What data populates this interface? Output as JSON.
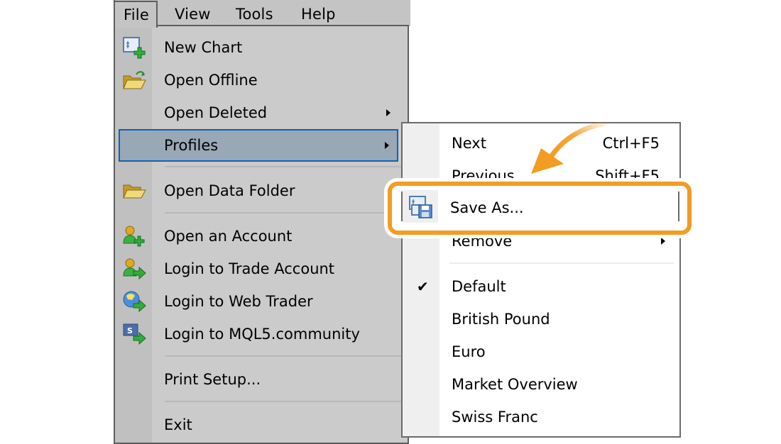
{
  "menubar": {
    "items": [
      {
        "label": "File",
        "active": true
      },
      {
        "label": "View"
      },
      {
        "label": "Tools"
      },
      {
        "label": "Help"
      }
    ]
  },
  "file_menu": {
    "items": [
      {
        "label": "New Chart",
        "icon": "new-chart-icon"
      },
      {
        "label": "Open Offline",
        "icon": "open-offline-folder-icon"
      },
      {
        "label": "Open Deleted",
        "submenu": true
      },
      {
        "label": "Profiles",
        "submenu": true,
        "highlighted": true
      },
      {
        "label": "Open Data Folder",
        "icon": "folder-icon"
      },
      {
        "label": "Open an Account",
        "icon": "user-add-icon"
      },
      {
        "label": "Login to Trade Account",
        "icon": "user-login-icon"
      },
      {
        "label": "Login to Web Trader",
        "icon": "globe-login-icon"
      },
      {
        "label": "Login to MQL5.community",
        "icon": "mql5-login-icon"
      },
      {
        "label": "Print Setup..."
      },
      {
        "label": "Exit"
      }
    ]
  },
  "profiles_submenu": {
    "items": [
      {
        "label": "Next",
        "shortcut": "Ctrl+F5"
      },
      {
        "label": "Previous",
        "shortcut": "Shift+F5"
      },
      {
        "label": "Save As...",
        "icon": "save-profile-icon",
        "emphasized": true
      },
      {
        "label": "Remove",
        "submenu": true
      },
      {
        "label": "Default",
        "checked": true
      },
      {
        "label": "British Pound"
      },
      {
        "label": "Euro"
      },
      {
        "label": "Market Overview"
      },
      {
        "label": "Swiss Franc"
      }
    ],
    "check_glyph": "✔"
  },
  "annotation": {
    "highlight_color": "#f29c22",
    "target": "Save As..."
  },
  "colors": {
    "menu_bg": "#cbcbcb",
    "highlight_bg": "#98a8b6",
    "highlight_border": "#0e63b4",
    "submenu_bg": "#ffffff"
  }
}
